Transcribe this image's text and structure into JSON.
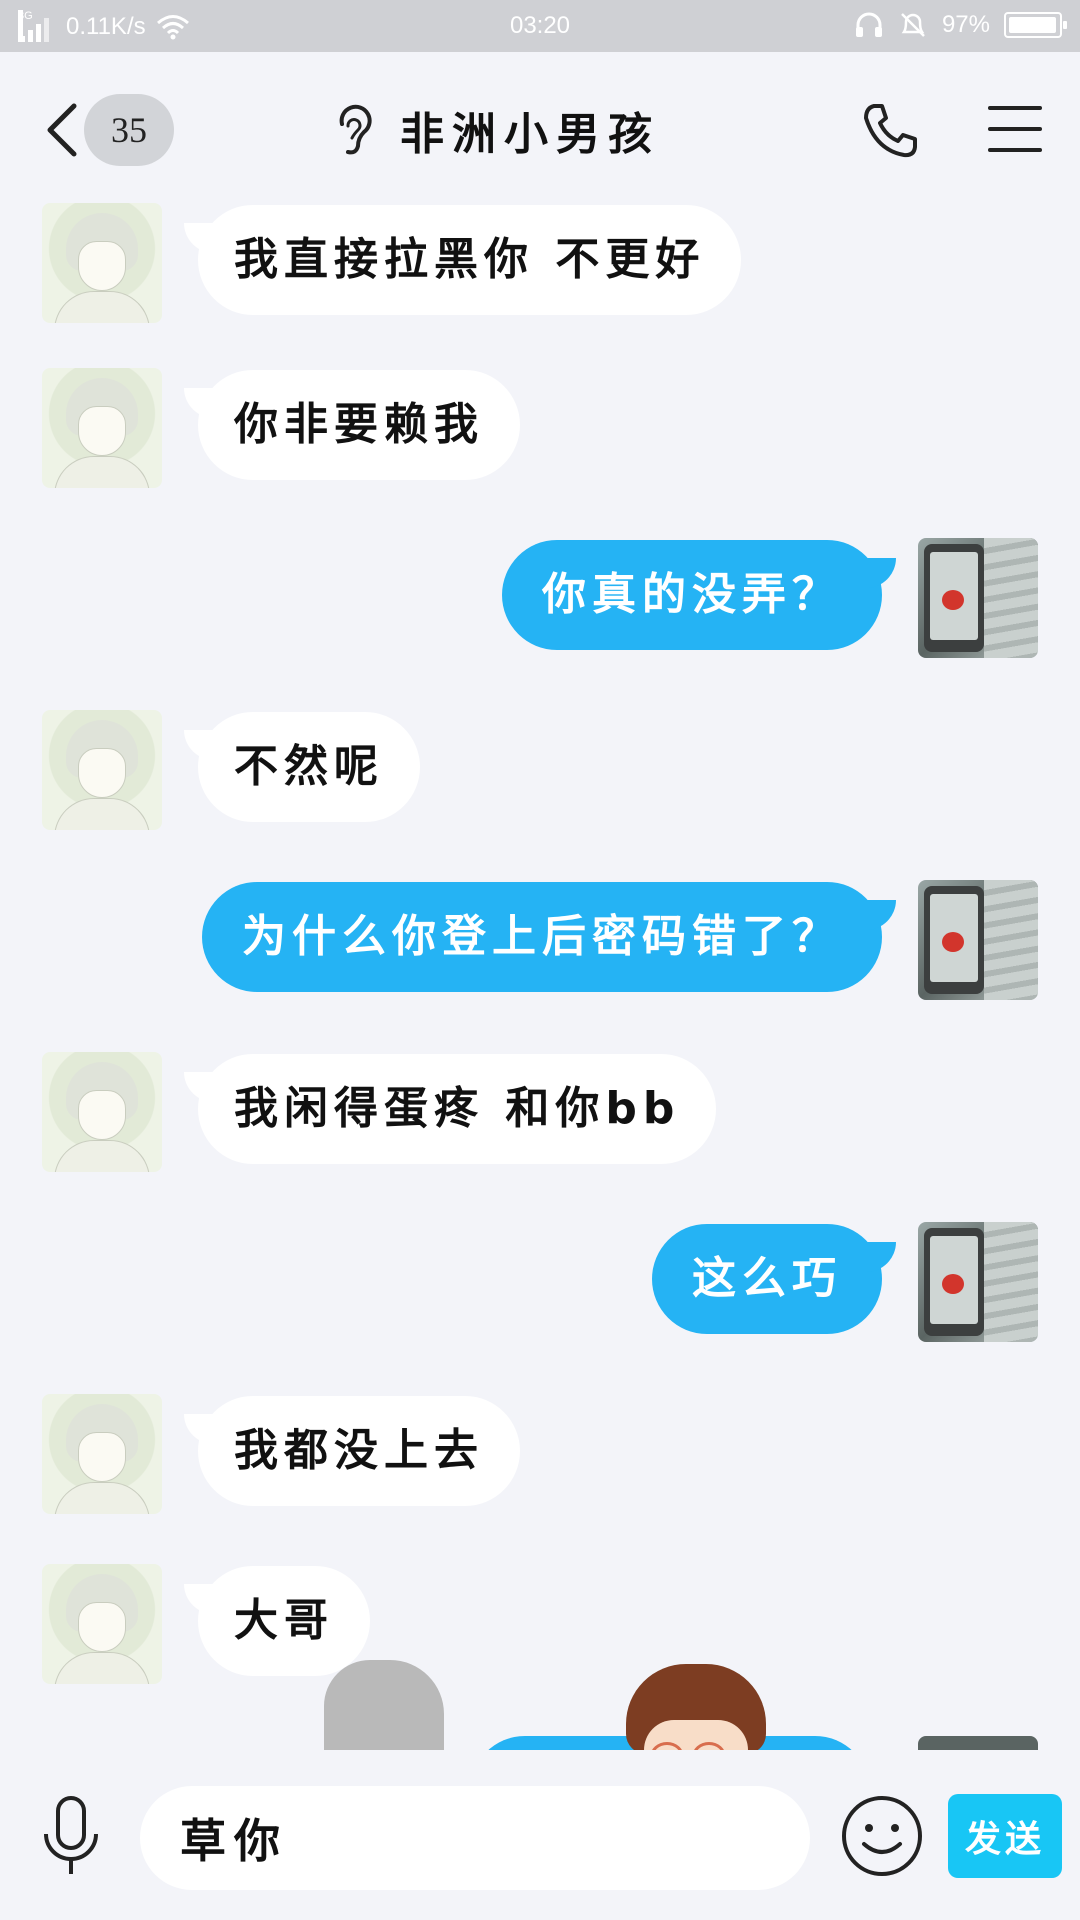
{
  "status_bar": {
    "network_type": "3G",
    "speed": "0.11K/s",
    "time": "03:20",
    "battery": "97%",
    "battery_level": 0.97
  },
  "header": {
    "unread_count": "35",
    "title": "非洲小男孩"
  },
  "messages": [
    {
      "sender": "other",
      "text": "我直接拉黑你 不更好"
    },
    {
      "sender": "other",
      "text": "你非要赖我"
    },
    {
      "sender": "self",
      "text": "你真的没弄？"
    },
    {
      "sender": "other",
      "text": "不然呢"
    },
    {
      "sender": "self",
      "text": "为什么你登上后密码错了？"
    },
    {
      "sender": "other",
      "text": "我闲得蛋疼 和你bb"
    },
    {
      "sender": "self",
      "text": "这么巧"
    },
    {
      "sender": "other",
      "text": "我都没上去"
    },
    {
      "sender": "other",
      "text": "大哥"
    }
  ],
  "input": {
    "value": "草你",
    "send_label": "发送"
  },
  "colors": {
    "self_bubble": "#25b3f4",
    "other_bubble": "#ffffff",
    "send_button": "#18c6f5",
    "status_bar": "#cfd0d4"
  },
  "icons": [
    "back-arrow-icon",
    "ear-icon",
    "phone-icon",
    "menu-icon",
    "mic-icon",
    "emoji-icon",
    "wifi-icon",
    "headset-icon",
    "bell-muted-icon",
    "battery-icon",
    "signal-icon"
  ]
}
